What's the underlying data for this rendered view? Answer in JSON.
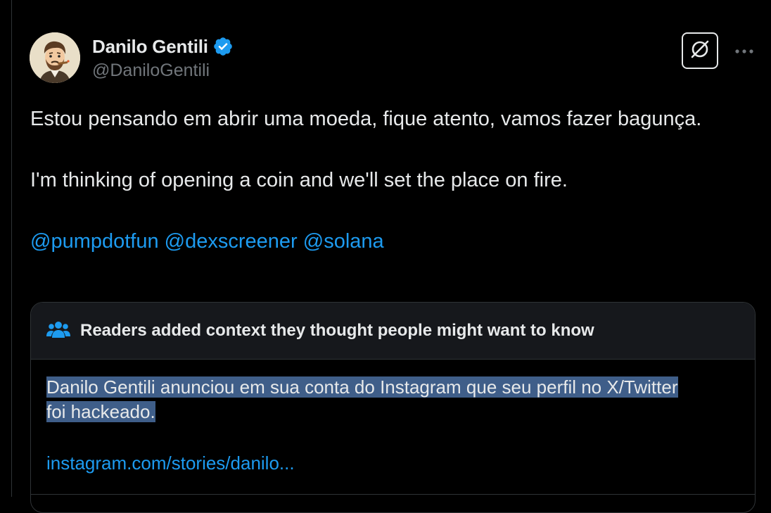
{
  "author": {
    "display_name": "Danilo Gentili",
    "handle": "@DaniloGentili",
    "verified": true,
    "avatar_icon": "cartoon-avatar"
  },
  "actions": {
    "grok_icon": "grok-icon",
    "more_icon": "more-icon"
  },
  "tweet": {
    "line_pt": "Estou pensando em abrir uma moeda, fique atento, vamos fazer bagunça.",
    "line_en": "I'm thinking of opening a coin and we'll set the place on fire.",
    "mentions": [
      "@pumpdotfun",
      "@dexscreener",
      "@solana"
    ]
  },
  "community_note": {
    "header_icon": "people-icon",
    "header": "Readers added context they thought people might want to know",
    "text_line1": "Danilo Gentili anunciou em sua conta do Instagram que seu perfil no X/Twitter",
    "text_line2": "foi hackeado.",
    "link": "instagram.com/stories/danilo..."
  },
  "colors": {
    "background": "#000000",
    "text": "#e7e9ea",
    "secondary_text": "#71767b",
    "link": "#1d9bf0",
    "verified_badge": "#1d9bf0",
    "note_header_bg": "#16181c",
    "selection_highlight": "#3f5e89",
    "border": "#2f3336"
  }
}
